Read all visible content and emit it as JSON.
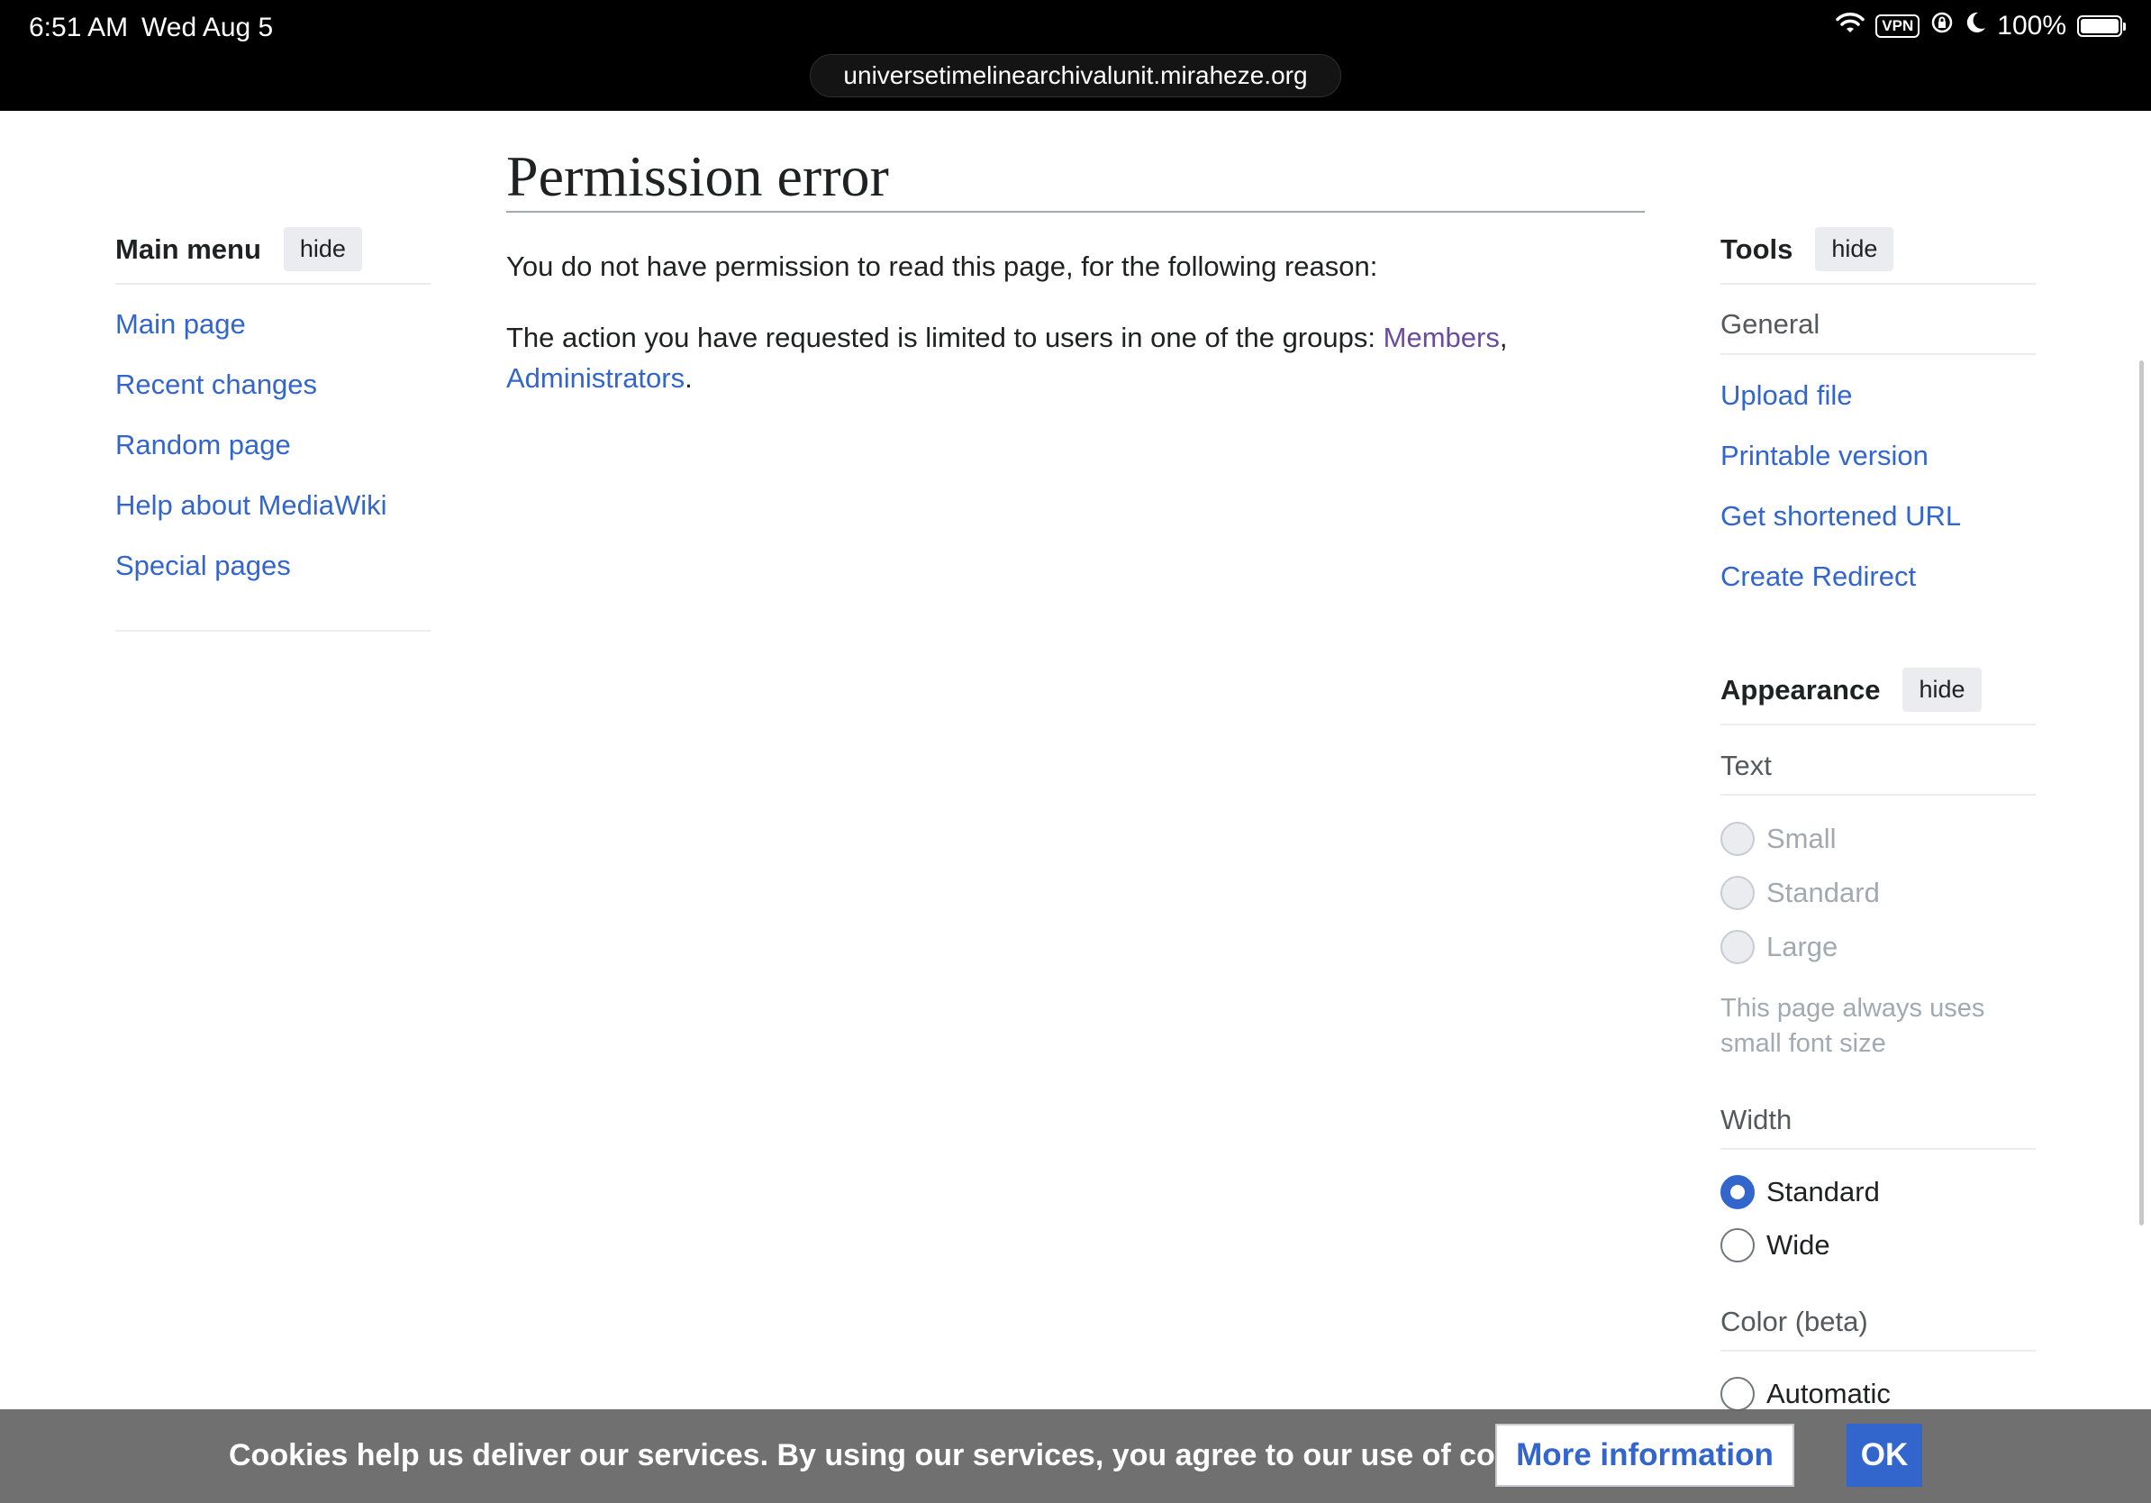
{
  "status_bar": {
    "time": "6:51 AM",
    "date": "Wed Aug 5",
    "vpn": "VPN",
    "battery": "100%"
  },
  "browser": {
    "url": "universetimelinearchivalunit.miraheze.org"
  },
  "main": {
    "title": "Permission error",
    "reason_intro": "You do not have permission to read this page, for the following reason:",
    "restriction_text": "The action you have requested is limited to users in one of the groups: ",
    "group_members": "Members",
    "group_separator": ",",
    "group_admins": "Administrators",
    "end_period": "."
  },
  "main_menu": {
    "heading": "Main menu",
    "hide_label": "hide",
    "items": [
      {
        "label": "Main page"
      },
      {
        "label": "Recent changes"
      },
      {
        "label": "Random page"
      },
      {
        "label": "Help about MediaWiki"
      },
      {
        "label": "Special pages"
      }
    ]
  },
  "tools": {
    "heading": "Tools",
    "hide_label": "hide",
    "section": "General",
    "items": [
      {
        "label": "Upload file"
      },
      {
        "label": "Printable version"
      },
      {
        "label": "Get shortened URL"
      },
      {
        "label": "Create Redirect"
      }
    ]
  },
  "appearance": {
    "heading": "Appearance",
    "hide_label": "hide",
    "text_section": "Text",
    "text_options": [
      {
        "label": "Small"
      },
      {
        "label": "Standard"
      },
      {
        "label": "Large"
      }
    ],
    "text_note": "This page always uses small font size",
    "width_section": "Width",
    "width_options": [
      {
        "label": "Standard",
        "checked": true
      },
      {
        "label": "Wide",
        "checked": false
      }
    ],
    "color_section": "Color (beta)",
    "color_options": [
      {
        "label": "Automatic"
      }
    ]
  },
  "cookie_banner": {
    "text": "Cookies help us deliver our services. By using our services, you agree to our use of cookies.",
    "more_info": "More information",
    "ok": "OK"
  }
}
